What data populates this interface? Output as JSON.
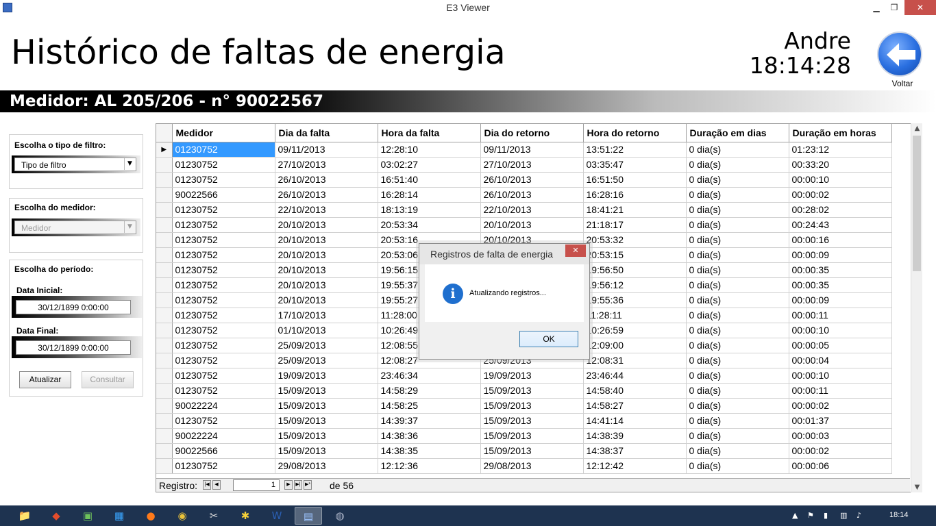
{
  "window": {
    "title": "E3 Viewer",
    "min": "▁",
    "max": "❐",
    "close": "✕"
  },
  "header": {
    "title": "Histórico de faltas de energia",
    "user": "Andre",
    "time": "18:14:28",
    "back_label": "Voltar"
  },
  "meter": {
    "text": "Medidor: AL 205/206 - n° 90022567"
  },
  "filters": {
    "filter_type_label": "Escolha o tipo de filtro:",
    "filter_type_value": "Tipo de filtro",
    "meter_label": "Escolha do medidor:",
    "meter_value": "Medidor",
    "period_label": "Escolha do período:",
    "start_label": "Data Inicial:",
    "start_value": "30/12/1899 0:00:00",
    "end_label": "Data Final:",
    "end_value": "30/12/1899 0:00:00",
    "refresh_button": "Atualizar",
    "query_button": "Consultar"
  },
  "grid": {
    "columns": [
      "Medidor",
      "Dia da falta",
      "Hora da falta",
      "Dia do retorno",
      "Hora do retorno",
      "Duração em dias",
      "Duração em horas"
    ],
    "current_row_marker": "▶",
    "rows": [
      [
        "01230752",
        "09/11/2013",
        "12:28:10",
        "09/11/2013",
        "13:51:22",
        "0 dia(s)",
        "01:23:12"
      ],
      [
        "01230752",
        "27/10/2013",
        "03:02:27",
        "27/10/2013",
        "03:35:47",
        "0 dia(s)",
        "00:33:20"
      ],
      [
        "01230752",
        "26/10/2013",
        "16:51:40",
        "26/10/2013",
        "16:51:50",
        "0 dia(s)",
        "00:00:10"
      ],
      [
        "90022566",
        "26/10/2013",
        "16:28:14",
        "26/10/2013",
        "16:28:16",
        "0 dia(s)",
        "00:00:02"
      ],
      [
        "01230752",
        "22/10/2013",
        "18:13:19",
        "22/10/2013",
        "18:41:21",
        "0 dia(s)",
        "00:28:02"
      ],
      [
        "01230752",
        "20/10/2013",
        "20:53:34",
        "20/10/2013",
        "21:18:17",
        "0 dia(s)",
        "00:24:43"
      ],
      [
        "01230752",
        "20/10/2013",
        "20:53:16",
        "20/10/2013",
        "20:53:32",
        "0 dia(s)",
        "00:00:16"
      ],
      [
        "01230752",
        "20/10/2013",
        "20:53:06",
        "",
        "20:53:15",
        "0 dia(s)",
        "00:00:09"
      ],
      [
        "01230752",
        "20/10/2013",
        "19:56:15",
        "",
        "19:56:50",
        "0 dia(s)",
        "00:00:35"
      ],
      [
        "01230752",
        "20/10/2013",
        "19:55:37",
        "",
        "19:56:12",
        "0 dia(s)",
        "00:00:35"
      ],
      [
        "01230752",
        "20/10/2013",
        "19:55:27",
        "",
        "19:55:36",
        "0 dia(s)",
        "00:00:09"
      ],
      [
        "01230752",
        "17/10/2013",
        "11:28:00",
        "",
        "11:28:11",
        "0 dia(s)",
        "00:00:11"
      ],
      [
        "01230752",
        "01/10/2013",
        "10:26:49",
        "",
        "10:26:59",
        "0 dia(s)",
        "00:00:10"
      ],
      [
        "01230752",
        "25/09/2013",
        "12:08:55",
        "",
        "12:09:00",
        "0 dia(s)",
        "00:00:05"
      ],
      [
        "01230752",
        "25/09/2013",
        "12:08:27",
        "25/09/2013",
        "12:08:31",
        "0 dia(s)",
        "00:00:04"
      ],
      [
        "01230752",
        "19/09/2013",
        "23:46:34",
        "19/09/2013",
        "23:46:44",
        "0 dia(s)",
        "00:00:10"
      ],
      [
        "01230752",
        "15/09/2013",
        "14:58:29",
        "15/09/2013",
        "14:58:40",
        "0 dia(s)",
        "00:00:11"
      ],
      [
        "90022224",
        "15/09/2013",
        "14:58:25",
        "15/09/2013",
        "14:58:27",
        "0 dia(s)",
        "00:00:02"
      ],
      [
        "01230752",
        "15/09/2013",
        "14:39:37",
        "15/09/2013",
        "14:41:14",
        "0 dia(s)",
        "00:01:37"
      ],
      [
        "90022224",
        "15/09/2013",
        "14:38:36",
        "15/09/2013",
        "14:38:39",
        "0 dia(s)",
        "00:00:03"
      ],
      [
        "90022566",
        "15/09/2013",
        "14:38:35",
        "15/09/2013",
        "14:38:37",
        "0 dia(s)",
        "00:00:02"
      ],
      [
        "01230752",
        "29/08/2013",
        "12:12:36",
        "29/08/2013",
        "12:12:42",
        "0 dia(s)",
        "00:00:06"
      ]
    ]
  },
  "navigator": {
    "label": "Registro:",
    "current": "1",
    "of_text": "de 56",
    "first": "|◀",
    "prev": "◀",
    "next": "▶",
    "last": "▶|",
    "new": "▶*"
  },
  "modal": {
    "title": "Registros de falta de energia",
    "close": "✕",
    "icon": "i",
    "message": "Atualizando registros...",
    "ok": "OK"
  },
  "taskbar": {
    "apps": [
      {
        "name": "file-explorer-icon",
        "glyph": "📁"
      },
      {
        "name": "app-red-icon",
        "glyph": "◆"
      },
      {
        "name": "app-green-icon",
        "glyph": "▣"
      },
      {
        "name": "app-blue-icon",
        "glyph": "▦"
      },
      {
        "name": "firefox-icon",
        "glyph": "●"
      },
      {
        "name": "chrome-icon",
        "glyph": "◉"
      },
      {
        "name": "tools-icon",
        "glyph": "✂"
      },
      {
        "name": "app-yellow-icon",
        "glyph": "✱"
      },
      {
        "name": "word-icon",
        "glyph": "W"
      },
      {
        "name": "e3-viewer-icon",
        "glyph": "▤"
      },
      {
        "name": "app-gray-icon",
        "glyph": "◍"
      }
    ],
    "clock": "18:14"
  }
}
